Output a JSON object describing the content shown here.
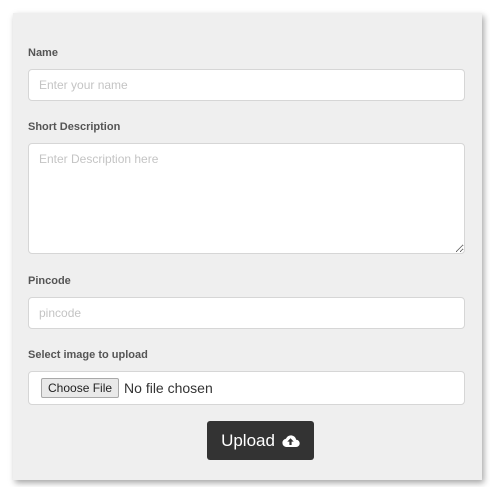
{
  "form": {
    "name_label": "Name",
    "name_placeholder": "Enter your name",
    "description_label": "Short Description",
    "description_placeholder": "Enter Description here",
    "pincode_label": "Pincode",
    "pincode_placeholder": "pincode",
    "image_label": "Select image to upload",
    "choose_file_label": "Choose File",
    "file_status": "No file chosen",
    "upload_label": "Upload",
    "upload_icon": "cloud-upload-icon"
  },
  "colors": {
    "panel_background": "#efefef",
    "button_background": "#333333",
    "button_text": "#ffffff"
  }
}
